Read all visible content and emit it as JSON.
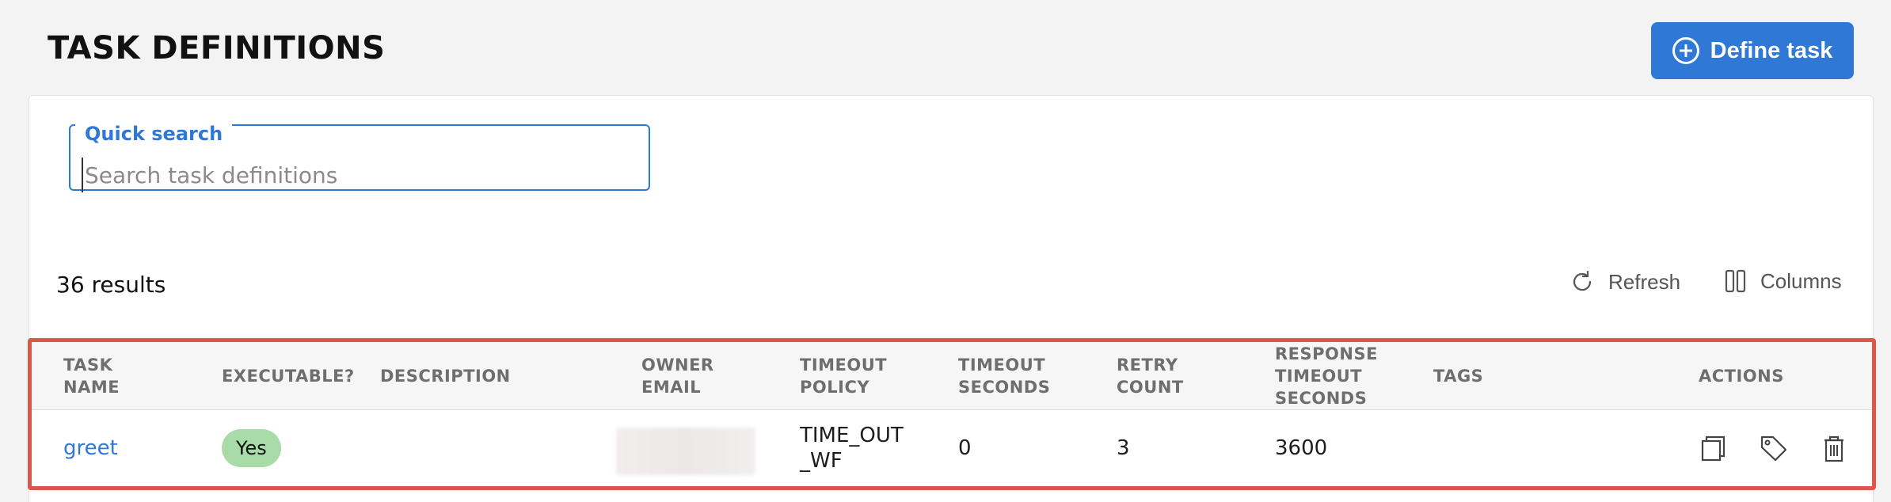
{
  "header": {
    "title": "TASK DEFINITIONS",
    "define_button_label": "Define task",
    "accent_color": "#2f78d6"
  },
  "search": {
    "legend": "Quick search",
    "placeholder": "Search task definitions",
    "value": ""
  },
  "results": {
    "count_label": "36 results",
    "refresh_label": "Refresh",
    "columns_label": "Columns"
  },
  "table": {
    "headers": [
      "TASK\nNAME",
      "EXECUTABLE?",
      "DESCRIPTION",
      "OWNER\nEMAIL",
      "TIMEOUT\nPOLICY",
      "TIMEOUT\nSECONDS",
      "RETRY\nCOUNT",
      "RESPONSE\nTIMEOUT\nSECONDS",
      "TAGS",
      "ACTIONS"
    ],
    "rows": [
      {
        "task_name": "greet",
        "executable": "Yes",
        "description": "",
        "owner_email": "",
        "timeout_policy": "TIME_OUT\n_WF",
        "timeout_seconds": "0",
        "retry_count": "3",
        "response_timeout_seconds": "3600",
        "tags": "",
        "actions": [
          "clone-icon",
          "tag-icon",
          "trash-icon"
        ]
      }
    ]
  },
  "highlight_color": "#d9584a"
}
